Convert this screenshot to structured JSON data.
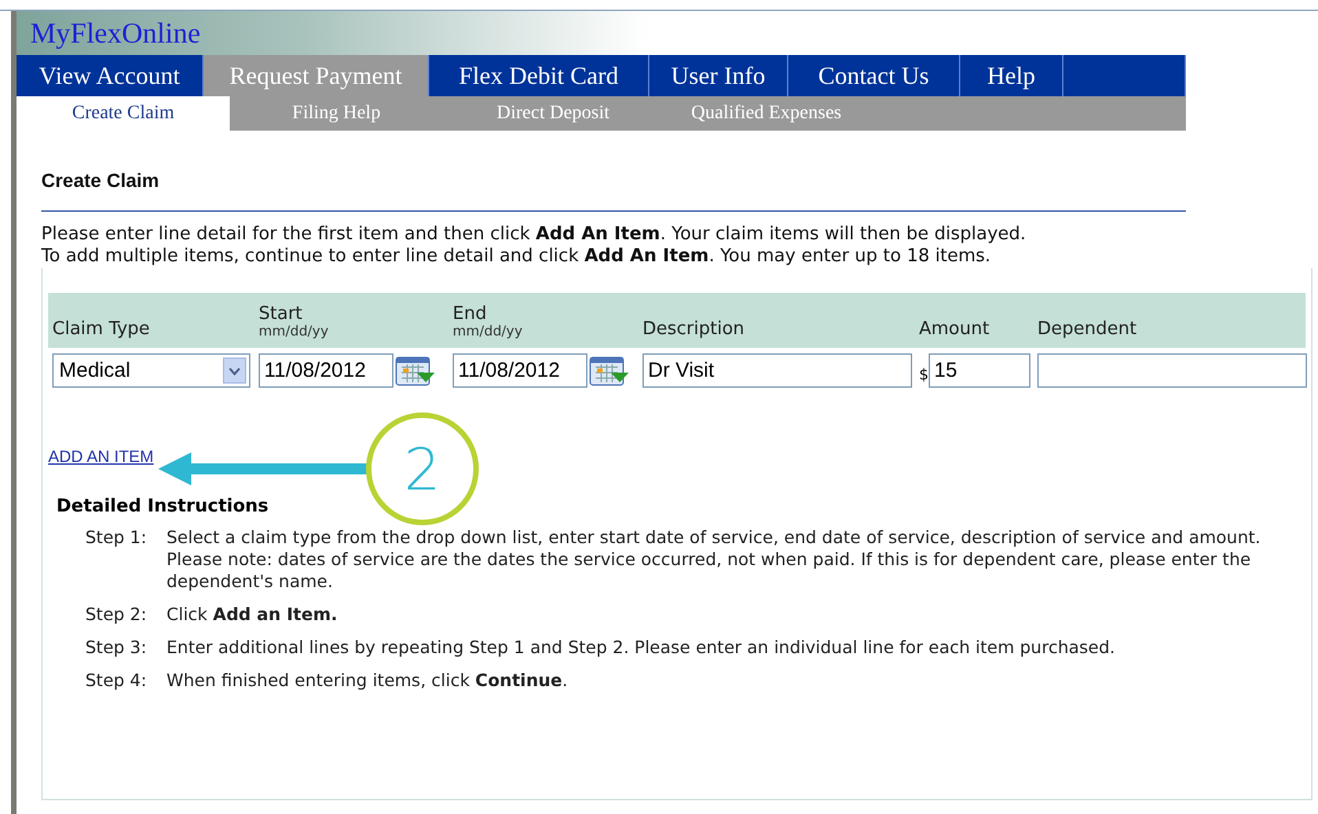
{
  "header": {
    "title": "MyFlexOnline"
  },
  "nav": [
    {
      "label": "View Account",
      "selected": false
    },
    {
      "label": "Request Payment",
      "selected": true
    },
    {
      "label": "Flex Debit Card",
      "selected": false
    },
    {
      "label": "User Info",
      "selected": false
    },
    {
      "label": "Contact Us",
      "selected": false
    },
    {
      "label": "Help",
      "selected": false
    }
  ],
  "subnav": [
    {
      "label": "Create Claim",
      "selected": true
    },
    {
      "label": "Filing Help",
      "selected": false
    },
    {
      "label": "Direct Deposit",
      "selected": false
    },
    {
      "label": "Qualified Expenses",
      "selected": false
    }
  ],
  "page_title": "Create Claim",
  "intro": [
    "Please enter line detail for the first item and then click **Add An Item**. Your claim items will then be displayed.",
    "To add multiple items, continue to enter line detail and click **Add An Item**. You may enter up to 18 items."
  ],
  "claim_table": {
    "columns": [
      {
        "label": "Claim Type"
      },
      {
        "label": "Start",
        "hint": "mm/dd/yy"
      },
      {
        "label": "End",
        "hint": "mm/dd/yy"
      },
      {
        "label": "Description"
      },
      {
        "label": "Amount"
      },
      {
        "label": "Dependent"
      }
    ],
    "row": {
      "claim_type": "Medical",
      "start": "11/08/2012",
      "end": "11/08/2012",
      "description": "Dr Visit",
      "currency": "$",
      "amount": "15"
    }
  },
  "add_item_link": "ADD AN ITEM",
  "callout": {
    "number": "2"
  },
  "instructions": {
    "title": "Detailed Instructions",
    "steps": [
      {
        "label": "Step 1:",
        "text": "Select a claim type from the drop down list, enter start date of service, end date of service, description of service and amount. Please note: dates of service are the dates the service occurred, not when paid. If this is for dependent care, please enter the dependent's name."
      },
      {
        "label": "Step 2:",
        "text": "Click **Add an Item.**"
      },
      {
        "label": "Step 3:",
        "text": "Enter additional lines by repeating Step 1 and Step 2. Please enter an individual line for each item purchased."
      },
      {
        "label": "Step 4:",
        "text": "When finished entering items, click **Continue**."
      }
    ]
  }
}
